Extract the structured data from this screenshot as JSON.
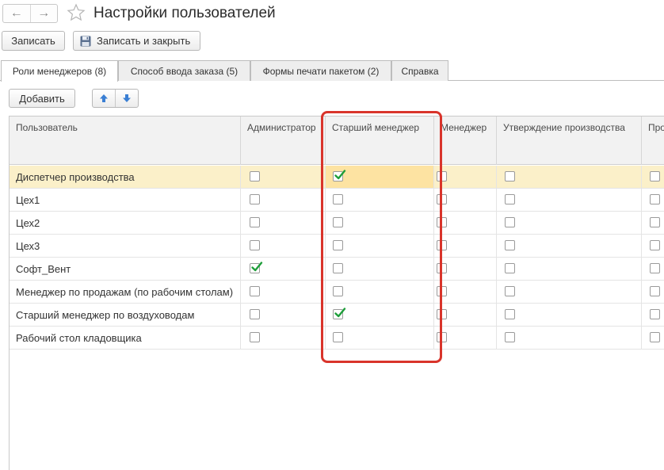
{
  "window": {
    "title": "Настройки пользователей",
    "back_icon": "←",
    "forward_icon": "→",
    "favorite_icon": "star-icon"
  },
  "command_bar": {
    "save_label": "Записать",
    "save_close_label": "Записать и закрыть"
  },
  "tabs": [
    {
      "label": "Роли менеджеров (8)",
      "active": true
    },
    {
      "label": "Способ ввода заказа (5)",
      "active": false
    },
    {
      "label": "Формы печати пакетом (2)",
      "active": false
    },
    {
      "label": "Справка",
      "active": false
    }
  ],
  "toolbar": {
    "add_label": "Добавить",
    "move_up_icon": "arrow-up-icon",
    "move_down_icon": "arrow-down-icon"
  },
  "table": {
    "columns": [
      "Пользователь",
      "Администратор",
      "Старший менеджер",
      "Менеджер",
      "Утверждение производства",
      "Про"
    ],
    "rows": [
      {
        "user": "Диспетчер производства",
        "selected": true,
        "checks": [
          false,
          true,
          false,
          false,
          false
        ]
      },
      {
        "user": "Цех1",
        "selected": false,
        "checks": [
          false,
          false,
          false,
          false,
          false
        ]
      },
      {
        "user": "Цех2",
        "selected": false,
        "checks": [
          false,
          false,
          false,
          false,
          false
        ]
      },
      {
        "user": "Цех3",
        "selected": false,
        "checks": [
          false,
          false,
          false,
          false,
          false
        ]
      },
      {
        "user": "Софт_Вент",
        "selected": false,
        "checks": [
          true,
          false,
          false,
          false,
          false
        ]
      },
      {
        "user": "Менеджер по продажам (по рабочим столам)",
        "selected": false,
        "checks": [
          false,
          false,
          false,
          false,
          false
        ]
      },
      {
        "user": "Старший менеджер по воздуховодам",
        "selected": false,
        "checks": [
          false,
          true,
          false,
          false,
          false
        ]
      },
      {
        "user": "Рабочий стол кладовщика",
        "selected": false,
        "checks": [
          false,
          false,
          false,
          false,
          false
        ]
      }
    ]
  },
  "colors": {
    "selected_row": "#fbf0c9",
    "current_cell": "#fde3a2",
    "check_mark": "#1e9e3a",
    "highlight_frame": "#d9342b",
    "arrow_buttons": "#3a7fd4"
  }
}
